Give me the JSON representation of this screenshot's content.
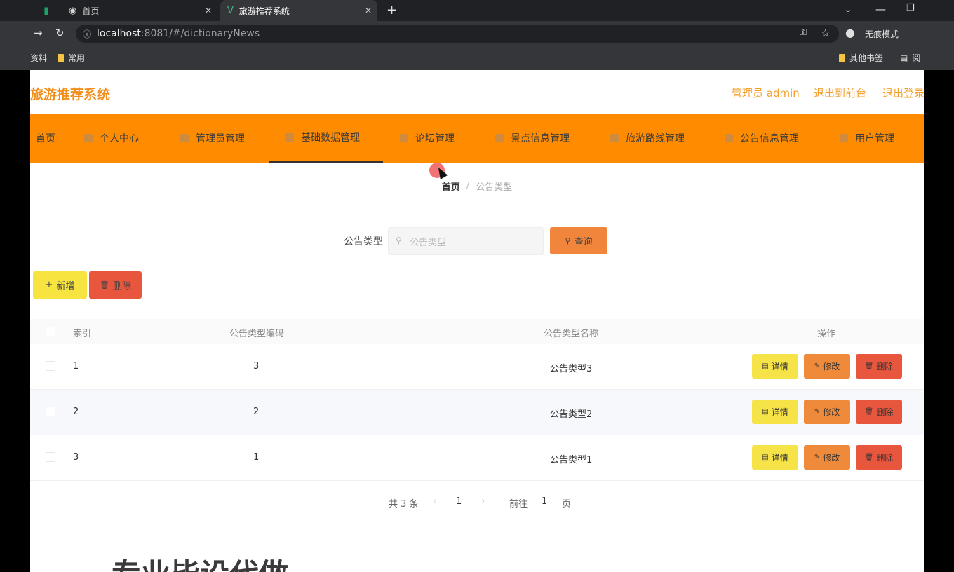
{
  "browser": {
    "tabs": [
      {
        "title": "首页"
      },
      {
        "title": "旅游推荐系统"
      }
    ],
    "new_tab_label": "+",
    "url_host": "localhost",
    "url_rest": ":8081/#/dictionaryNews",
    "profile_label": "无痕模式",
    "bookmarks": [
      "资料",
      "常用",
      "其他书签",
      "阅"
    ]
  },
  "header": {
    "brand": "旅游推荐系统",
    "admin_label": "管理员 admin",
    "back_label": "退出到前台",
    "logout_label": "退出登录"
  },
  "nav": {
    "items": [
      {
        "label": "首页"
      },
      {
        "label": "个人中心"
      },
      {
        "label": "管理员管理"
      },
      {
        "label": "基础数据管理"
      },
      {
        "label": "论坛管理"
      },
      {
        "label": "景点信息管理"
      },
      {
        "label": "旅游路线管理"
      },
      {
        "label": "公告信息管理"
      },
      {
        "label": "用户管理"
      }
    ]
  },
  "breadcrumb": {
    "home": "首页",
    "separator": "/",
    "current": "公告类型"
  },
  "search": {
    "label": "公告类型",
    "placeholder": "公告类型",
    "query_button": "查询"
  },
  "toolbar": {
    "add_button": "新增",
    "delete_button": "删除"
  },
  "table": {
    "columns": [
      "索引",
      "公告类型编码",
      "公告类型名称",
      "操作"
    ],
    "rows": [
      {
        "index": "1",
        "code": "3",
        "name": "公告类型3"
      },
      {
        "index": "2",
        "code": "2",
        "name": "公告类型2"
      },
      {
        "index": "3",
        "code": "1",
        "name": "公告类型1"
      }
    ],
    "actions": {
      "detail": "详情",
      "edit": "修改",
      "delete": "删除"
    }
  },
  "pagination": {
    "total": "共 3 条",
    "page": "1",
    "goto_label": "前往",
    "goto_value": "1",
    "page_unit": "页"
  },
  "watermark": "专业毕设代做",
  "colors": {
    "nav_bg": "#ff8c00",
    "brand": "#f28e1c",
    "yellow": "#f7e441",
    "orange": "#f1853b",
    "red": "#e9563e"
  }
}
